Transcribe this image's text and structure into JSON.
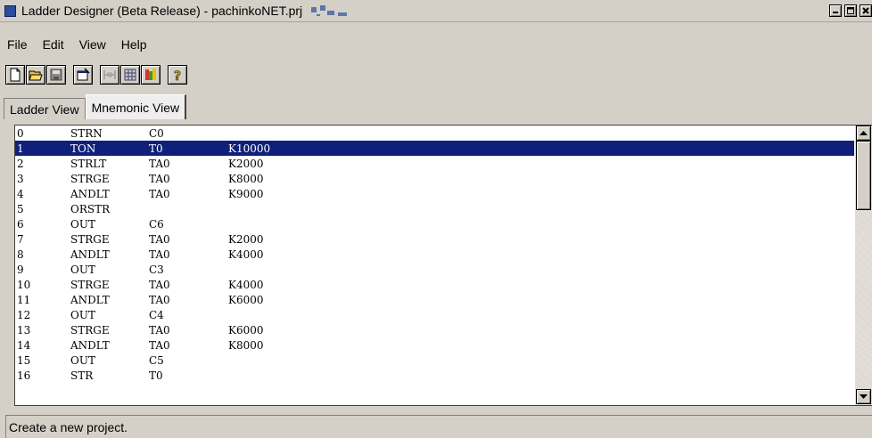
{
  "window": {
    "title": "Ladder Designer (Beta Release) - pachinkoNET.prj"
  },
  "menu": [
    {
      "label": "File"
    },
    {
      "label": "Edit"
    },
    {
      "label": "View"
    },
    {
      "label": "Help"
    }
  ],
  "toolbar": {
    "icons": [
      "new-file-icon",
      "open-folder-icon",
      "save-disk-icon",
      "properties-icon",
      "ladder-icon",
      "grid-icon",
      "color-bars-icon",
      "help-icon"
    ]
  },
  "tabs": [
    {
      "label": "Ladder View",
      "active": false
    },
    {
      "label": "Mnemonic View",
      "active": true
    }
  ],
  "mnemonics": {
    "selected_index": 1,
    "rows": [
      [
        "0",
        "STRN",
        "C0",
        ""
      ],
      [
        "1",
        "TON",
        "T0",
        "K10000"
      ],
      [
        "2",
        "STRLT",
        "TA0",
        "K2000"
      ],
      [
        "3",
        "STRGE",
        "TA0",
        "K8000"
      ],
      [
        "4",
        "ANDLT",
        "TA0",
        "K9000"
      ],
      [
        "5",
        "ORSTR",
        "",
        ""
      ],
      [
        "6",
        "OUT",
        "C6",
        ""
      ],
      [
        "7",
        "STRGE",
        "TA0",
        "K2000"
      ],
      [
        "8",
        "ANDLT",
        "TA0",
        "K4000"
      ],
      [
        "9",
        "OUT",
        "C3",
        ""
      ],
      [
        "10",
        "STRGE",
        "TA0",
        "K4000"
      ],
      [
        "11",
        "ANDLT",
        "TA0",
        "K6000"
      ],
      [
        "12",
        "OUT",
        "C4",
        ""
      ],
      [
        "13",
        "STRGE",
        "TA0",
        "K6000"
      ],
      [
        "14",
        "ANDLT",
        "TA0",
        "K8000"
      ],
      [
        "15",
        "OUT",
        "C5",
        ""
      ],
      [
        "16",
        "STR",
        "T0",
        ""
      ]
    ]
  },
  "status": {
    "text": "Create a new project."
  },
  "colors": {
    "selection": "#10207a",
    "window_bg": "#d4d0c8"
  }
}
